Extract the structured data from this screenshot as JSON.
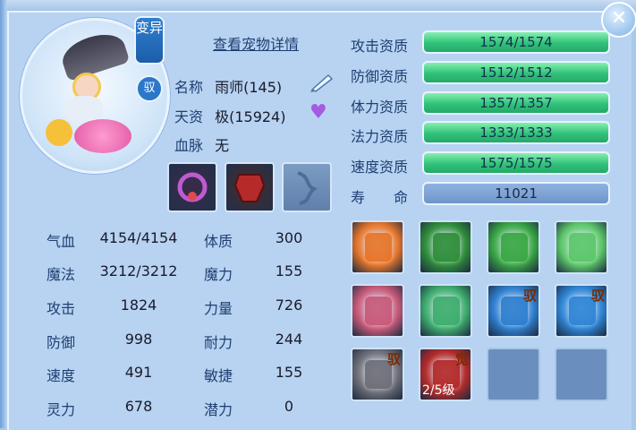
{
  "window": {
    "close_symbol": "✕"
  },
  "pet": {
    "badge_transform": "变异",
    "badge_mount": "驭",
    "details_link": "查看宠物详情",
    "name_label": "名称",
    "name_value": "雨师(145)",
    "talent_label": "天资",
    "talent_value": "极(15924)",
    "bloodline_label": "血脉",
    "bloodline_value": "无"
  },
  "stats": [
    {
      "label": "气血",
      "value": "4154/4154"
    },
    {
      "label": "魔法",
      "value": "3212/3212"
    },
    {
      "label": "攻击",
      "value": "1824"
    },
    {
      "label": "防御",
      "value": "998"
    },
    {
      "label": "速度",
      "value": "491"
    },
    {
      "label": "灵力",
      "value": "678"
    }
  ],
  "attributes": [
    {
      "label": "体质",
      "value": "300"
    },
    {
      "label": "魔力",
      "value": "155"
    },
    {
      "label": "力量",
      "value": "726"
    },
    {
      "label": "耐力",
      "value": "244"
    },
    {
      "label": "敏捷",
      "value": "155"
    },
    {
      "label": "潜力",
      "value": "0"
    }
  ],
  "aptitudes": [
    {
      "label": "攻击资质",
      "value": "1574/1574"
    },
    {
      "label": "防御资质",
      "value": "1512/1512"
    },
    {
      "label": "体力资质",
      "value": "1357/1357"
    },
    {
      "label": "法力资质",
      "value": "1333/1333"
    },
    {
      "label": "速度资质",
      "value": "1575/1575"
    },
    {
      "label": "寿　　命",
      "value": "11021"
    }
  ],
  "skills": [
    {
      "icon": "flame-sword-icon",
      "tag": "",
      "level": "",
      "color": "#e8762a"
    },
    {
      "icon": "shadow-warrior-icon",
      "tag": "",
      "level": "",
      "color": "#2f8f3a"
    },
    {
      "icon": "green-giant-icon",
      "tag": "",
      "level": "",
      "color": "#3aa844"
    },
    {
      "icon": "heart-star-icon",
      "tag": "",
      "level": "",
      "color": "#5dc86a"
    },
    {
      "icon": "fire-scroll-icon",
      "tag": "",
      "level": "",
      "color": "#c95a7a"
    },
    {
      "icon": "green-shield-swirl-icon",
      "tag": "",
      "level": "",
      "color": "#3fae6e"
    },
    {
      "icon": "blue-shield-icon",
      "tag": "驭",
      "level": "",
      "color": "#2f7fd0"
    },
    {
      "icon": "water-swirl-icon",
      "tag": "驭",
      "level": "",
      "color": "#2f86d6"
    },
    {
      "icon": "silver-claw-icon",
      "tag": "驭",
      "level": "",
      "color": "#6f6f78"
    },
    {
      "icon": "awakened-red-icon",
      "tag": "觉",
      "level": "2/5级",
      "color": "#b52a2a"
    },
    {
      "icon": "empty-slot",
      "tag": "",
      "level": "",
      "color": "#6a8fbe"
    },
    {
      "icon": "empty-slot",
      "tag": "",
      "level": "",
      "color": "#6a8fbe"
    }
  ]
}
